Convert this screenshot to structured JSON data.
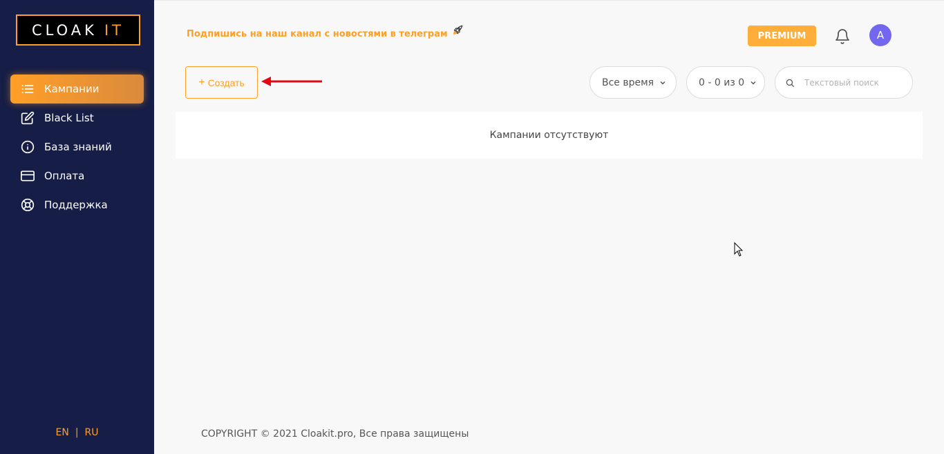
{
  "logo": {
    "text_white": "CLOAK",
    "text_orange": "IT"
  },
  "sidebar": {
    "items": [
      {
        "label": "Кампании",
        "icon": "list-icon",
        "active": true
      },
      {
        "label": "Black List",
        "icon": "edit-icon",
        "active": false
      },
      {
        "label": "База знаний",
        "icon": "info-icon",
        "active": false
      },
      {
        "label": "Оплата",
        "icon": "credit-card-icon",
        "active": false
      },
      {
        "label": "Поддержка",
        "icon": "life-buoy-icon",
        "active": false
      }
    ],
    "lang": {
      "en": "EN",
      "sep": "|",
      "ru": "RU"
    }
  },
  "header": {
    "telegram_text": "Подпишись на наш канал с новостями в телеграм",
    "premium_label": "PREMIUM",
    "avatar_initial": "A"
  },
  "toolbar": {
    "create_label": "Создать",
    "period_value": "Все время",
    "pager_value": "0 - 0 из 0",
    "search_placeholder": "Текстовый поиск"
  },
  "main": {
    "empty_text": "Кампании отсутствуют"
  },
  "footer": {
    "copyright": "COPYRIGHT © 2021 Cloakit.pro, Все права защищены"
  },
  "colors": {
    "sidebar_bg": "#161d46",
    "accent": "#ff9f26",
    "premium_bg": "#ffae3a",
    "avatar_bg": "#7367f0",
    "arrow": "#e30613"
  }
}
